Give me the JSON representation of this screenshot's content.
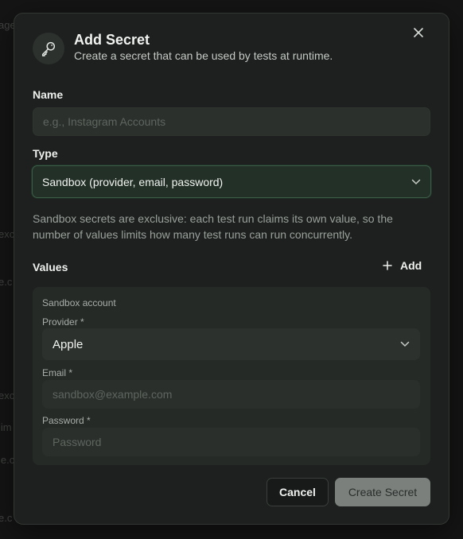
{
  "background": {
    "fragments": [
      "age",
      "exc",
      "e.c",
      "exc",
      "lim",
      "le.c",
      "e.c"
    ]
  },
  "dialog": {
    "title": "Add Secret",
    "subtitle": "Create a secret that can be used by tests at runtime.",
    "close_icon": "close-icon",
    "badge_icon": "key-icon"
  },
  "name_field": {
    "label": "Name",
    "placeholder": "e.g., Instagram Accounts",
    "value": ""
  },
  "type_field": {
    "label": "Type",
    "selected": "Sandbox (provider, email, password)",
    "help": "Sandbox secrets are exclusive: each test run claims its own value, so the number of values limits how many test runs can run concurrently."
  },
  "values": {
    "label": "Values",
    "add_label": "Add",
    "account": {
      "heading": "Sandbox account",
      "provider_label": "Provider *",
      "provider_selected": "Apple",
      "email_label": "Email *",
      "email_placeholder": "sandbox@example.com",
      "password_label": "Password *",
      "password_placeholder": "Password"
    }
  },
  "footer": {
    "cancel_label": "Cancel",
    "create_label": "Create Secret"
  },
  "colors": {
    "accent_border": "#3d5c48",
    "disabled_button": "#7b807c"
  }
}
